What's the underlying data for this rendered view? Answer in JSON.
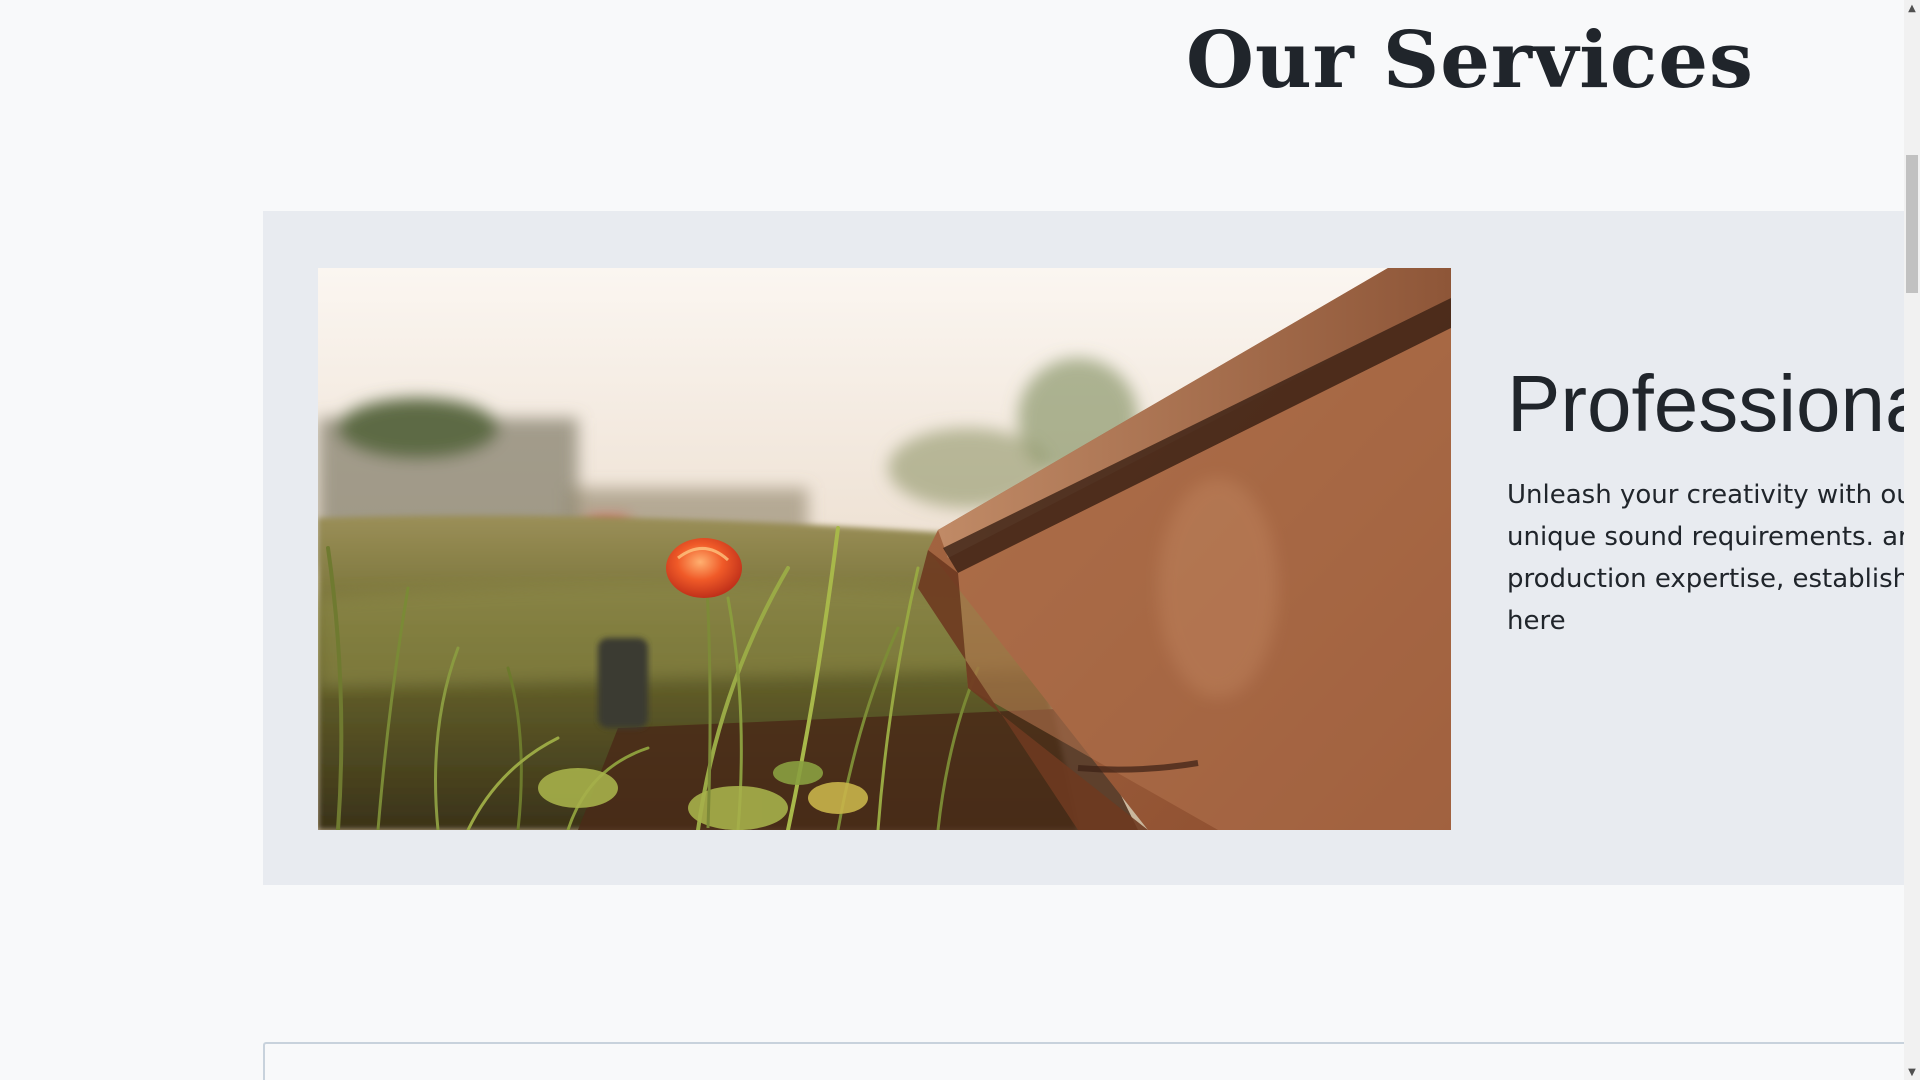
{
  "page": {
    "section_title": "Our Services"
  },
  "service_card": {
    "heading": "Professional Production",
    "description": "Unleash your creativity with our meet your unique sound requirements. art studios and production expertise, established musician, we're here",
    "image": {
      "subject": "red-poppy-beside-rusty-rail-photo"
    }
  },
  "scrollbar": {
    "up_icon": "▲",
    "down_icon": "▼",
    "position": 0.14
  },
  "colors": {
    "page_background": "#f8f9fa",
    "card_background": "#e8ebf0",
    "text": "#20252b",
    "next_card_border": "#c8d2dc"
  }
}
